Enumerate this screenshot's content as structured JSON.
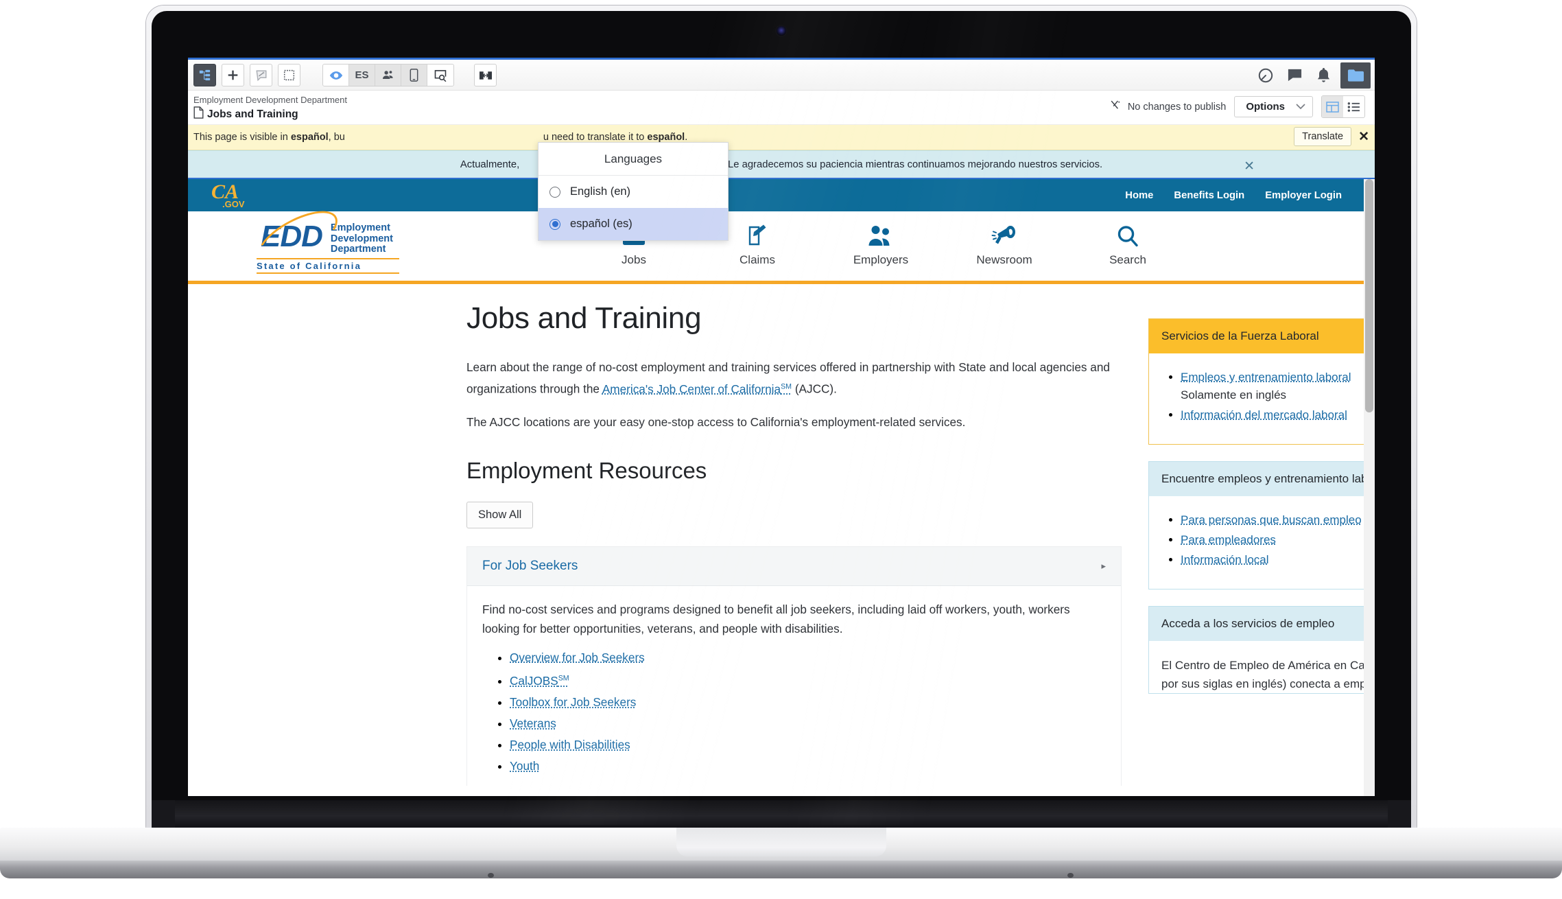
{
  "cms_toolbar": {
    "buttons": [
      {
        "name": "site-tree-icon",
        "label": "",
        "active": true
      },
      {
        "name": "add-icon",
        "label": ""
      },
      {
        "name": "annotation-icon",
        "label": ""
      },
      {
        "name": "select-region-icon",
        "label": ""
      },
      {
        "name": "preview-eye-icon",
        "label": ""
      }
    ],
    "segment": [
      {
        "name": "language-es-button",
        "label": "ES"
      },
      {
        "name": "personas-icon",
        "label": ""
      },
      {
        "name": "mobile-device-icon",
        "label": ""
      },
      {
        "name": "inspect-page-icon",
        "label": ""
      }
    ],
    "expand_label": "",
    "right_icons": [
      {
        "name": "history-clock-icon"
      },
      {
        "name": "comment-icon"
      },
      {
        "name": "notification-bell-icon"
      },
      {
        "name": "assets-folder-icon"
      }
    ]
  },
  "breadcrumb": {
    "parent": "Employment Development Department",
    "current": "Jobs and Training",
    "publish_status": "No changes to publish",
    "options_label": "Options"
  },
  "translate_banner": {
    "text_before": "This page is visible in ",
    "lang_1": "español",
    "text_middle": ", bu",
    "text_after": "u need to translate it to ",
    "lang_2": "español",
    "text_end": ".",
    "button_label": "Translate",
    "close_label": "✕"
  },
  "teal_banner": {
    "text_left": "Actualmente,",
    "text_right": "spañol. Le agradecemos su paciencia mientras continuamos mejorando nuestros servicios.",
    "close_label": "✕"
  },
  "languages_dropdown": {
    "title": "Languages",
    "options": [
      {
        "label": "English (en)",
        "selected": false
      },
      {
        "label": "español (es)",
        "selected": true
      }
    ]
  },
  "ca_strip": {
    "logo": "CA.GOV",
    "links": [
      "Home",
      "Benefits Login",
      "Employer Login"
    ]
  },
  "masthead": {
    "logo": {
      "mark": "EDD",
      "line1": "Employment",
      "line2": "Development",
      "line3": "Department",
      "state": "State of California"
    },
    "nav": [
      {
        "label": "Jobs",
        "icon": "briefcase-icon"
      },
      {
        "label": "Claims",
        "icon": "form-pen-icon"
      },
      {
        "label": "Employers",
        "icon": "people-icon"
      },
      {
        "label": "Newsroom",
        "icon": "megaphone-icon"
      },
      {
        "label": "Search",
        "icon": "search-icon"
      }
    ]
  },
  "main": {
    "title": "Jobs and Training",
    "intro_part1": "Learn about the range of no-cost employment and training services offered in partnership with State and local agencies and organizations through the ",
    "intro_link": "America's Job Center of California",
    "intro_link_sup": "SM",
    "intro_part2": " (AJCC).",
    "intro_p2": "The AJCC locations are your easy one-stop access to California's employment-related services.",
    "section_title": "Employment Resources",
    "show_all_label": "Show All",
    "accordion": {
      "title": "For Job Seekers",
      "caret": "▸",
      "body": "Find no-cost services and programs designed to benefit all job seekers, including laid off workers, youth, workers looking for better opportunities, veterans, and people with disabilities.",
      "links": [
        {
          "label": "Overview for Job Seekers",
          "sup": ""
        },
        {
          "label": "CalJOBS",
          "sup": "SM"
        },
        {
          "label": "Toolbox for Job Seekers",
          "sup": ""
        },
        {
          "label": "Veterans",
          "sup": ""
        },
        {
          "label": "People with Disabilities",
          "sup": ""
        },
        {
          "label": "Youth",
          "sup": ""
        }
      ]
    }
  },
  "sidebar": {
    "cards": [
      {
        "style": "gold",
        "heading": "Servicios de la Fuerza Laboral",
        "links": [
          "Empleos y entrenamiento laboral",
          "Información del mercado laboral"
        ],
        "note": "Solamente en inglés",
        "text": ""
      },
      {
        "style": "blue",
        "heading": "Encuentre empleos y entrenamiento laboral para usted",
        "links": [
          "Para personas que buscan empleo",
          "Para empleadores",
          "Información local"
        ],
        "note": "",
        "text": ""
      },
      {
        "style": "blue",
        "heading": "Acceda a los servicios de empleo",
        "links": [],
        "note": "",
        "text": "El Centro de Empleo de América en California (AJCC, por sus siglas en inglés) conecta a empleadores con"
      }
    ]
  },
  "colors": {
    "ca_blue": "#0d6c99",
    "edd_gold": "#f5a623",
    "link_blue": "#1a6ba5",
    "banner_yellow": "#fdf6cd",
    "banner_teal": "#d5ebf0",
    "card_gold": "#fbbe2b",
    "card_blue": "#d8ecf3"
  }
}
